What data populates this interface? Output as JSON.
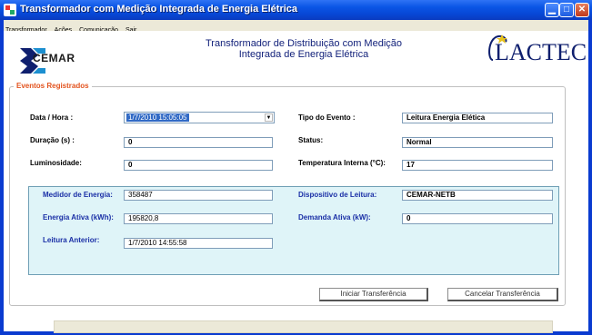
{
  "window": {
    "title": "Transformador com Medição Integrada de Energia Elétrica",
    "minimize": "▁",
    "maximize": "□",
    "close": "✕"
  },
  "menu": [
    "Transformador",
    "Ações",
    "Comunicação",
    "Sair"
  ],
  "header": {
    "logo_left_text": "CEMAR",
    "title_line1": "Transformador de Distribuição  com Medição",
    "title_line2": "Integrada de Energia Elétrica",
    "logo_right_text": "LACTEC"
  },
  "events": {
    "legend": "Eventos Registrados",
    "datetime_label": "Data / Hora :",
    "datetime_value": "1/7/2010 15:05:05",
    "duration_label": "Duração (s) :",
    "duration_value": "0",
    "luminosity_label": "Luminosidade:",
    "luminosity_value": "0",
    "event_type_label": "Tipo do Evento :",
    "event_type_value": "Leitura Energia Elética",
    "status_label": "Status:",
    "status_value": "Normal",
    "temperature_label": "Temperatura Interna (°C):",
    "temperature_value": "17"
  },
  "meter": {
    "meter_label": "Medidor de Energia:",
    "meter_value": "358487",
    "active_energy_label": "Energia Ativa (kWh):",
    "active_energy_value": "195820,8",
    "previous_reading_label": "Leitura Anterior:",
    "previous_reading_value": "1/7/2010 14:55:58",
    "device_label": "Dispositivo de Leitura:",
    "device_value": "CEMAR-NETB",
    "demand_label": "Demanda Ativa (kW):",
    "demand_value": "0"
  },
  "buttons": {
    "start": "Iniciar Transferência",
    "cancel": "Cancelar Transferência"
  },
  "colors": {
    "title_bar": "#0b56e6",
    "legend": "#e3531e",
    "header_title": "#12217a",
    "meter_panel": "#dff4f8",
    "selection": "#316ac5"
  }
}
